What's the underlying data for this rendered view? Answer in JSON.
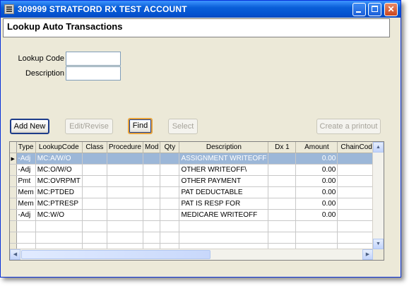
{
  "window": {
    "title": "309999 STRATFORD RX TEST ACCOUNT",
    "min_glyph": "",
    "max_glyph": "",
    "close_glyph": "✕"
  },
  "page": {
    "title": "Lookup Auto Transactions"
  },
  "form": {
    "lookup_code_label": "Lookup Code",
    "lookup_code_value": "",
    "description_label": "Description",
    "description_value": ""
  },
  "buttons": {
    "add_new": "Add New",
    "edit_revise": "Edit/Revise",
    "find": "Find",
    "select": "Select",
    "printout": "Create a printout"
  },
  "grid": {
    "columns": [
      "Type",
      "LookupCode",
      "Class",
      "Procedure",
      "Mod",
      "Qty",
      "Description",
      "Dx 1",
      "Amount",
      "ChainCode"
    ],
    "rows": [
      [
        "-Adj",
        "MC:A/W/O",
        "",
        "",
        "",
        "",
        "ASSIGNMENT WRITEOFF",
        "",
        "0.00",
        ""
      ],
      [
        "-Adj",
        "MC:O/W/O",
        "",
        "",
        "",
        "",
        "OTHER WRITEOFF\\",
        "",
        "0.00",
        ""
      ],
      [
        "Pmt",
        "MC:OVRPMT",
        "",
        "",
        "",
        "",
        "OTHER PAYMENT",
        "",
        "0.00",
        ""
      ],
      [
        "Mem",
        "MC:PTDED",
        "",
        "",
        "",
        "",
        "PAT DEDUCTABLE",
        "",
        "0.00",
        ""
      ],
      [
        "Mem",
        "MC:PTRESP",
        "",
        "",
        "",
        "",
        "PAT IS RESP FOR",
        "",
        "0.00",
        ""
      ],
      [
        "-Adj",
        "MC:W/O",
        "",
        "",
        "",
        "",
        "MEDICARE WRITEOFF",
        "",
        "0.00",
        ""
      ]
    ],
    "selected_row": 0,
    "current_row_marker": "▶"
  },
  "colors": {
    "selection": "#9cb7d8",
    "titlebar": "#0a5fd8"
  }
}
